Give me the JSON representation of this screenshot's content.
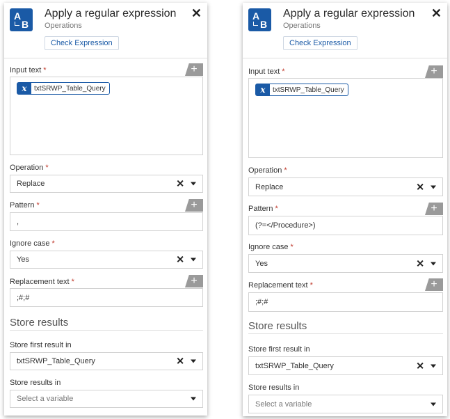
{
  "panels": [
    {
      "title": "Apply a regular expression",
      "subtitle": "Operations",
      "check_button": "Check Expression",
      "input_text": {
        "label": "Input text",
        "variable": "txtSRWP_Table_Query"
      },
      "operation": {
        "label": "Operation",
        "value": "Replace"
      },
      "pattern": {
        "label": "Pattern",
        "value": ","
      },
      "ignore_case": {
        "label": "Ignore case",
        "value": "Yes"
      },
      "replacement": {
        "label": "Replacement text",
        "value": ";#;#"
      },
      "store_results_title": "Store results",
      "store_first": {
        "label": "Store first result in",
        "value": "txtSRWP_Table_Query"
      },
      "store_all": {
        "label": "Store results in",
        "placeholder": "Select a variable"
      }
    },
    {
      "title": "Apply a regular expression",
      "subtitle": "Operations",
      "check_button": "Check Expression",
      "input_text": {
        "label": "Input text",
        "variable": "txtSRWP_Table_Query"
      },
      "operation": {
        "label": "Operation",
        "value": "Replace"
      },
      "pattern": {
        "label": "Pattern",
        "value": "(?=</Procedure>)"
      },
      "ignore_case": {
        "label": "Ignore case",
        "value": "Yes"
      },
      "replacement": {
        "label": "Replacement text",
        "value": ";#;#"
      },
      "store_results_title": "Store results",
      "store_first": {
        "label": "Store first result in",
        "value": "txtSRWP_Table_Query"
      },
      "store_all": {
        "label": "Store results in",
        "placeholder": "Select a variable"
      }
    }
  ],
  "required_marker": "*",
  "icons": {
    "app": "regex-a-to-b-icon",
    "close": "close-icon",
    "add": "plus-icon",
    "variable": "variable-x-icon",
    "clear": "clear-x-icon",
    "caret": "chevron-down-icon"
  },
  "colors": {
    "accent": "#1a5aa6",
    "required": "#c0392b",
    "tab": "#9a9a9a"
  }
}
